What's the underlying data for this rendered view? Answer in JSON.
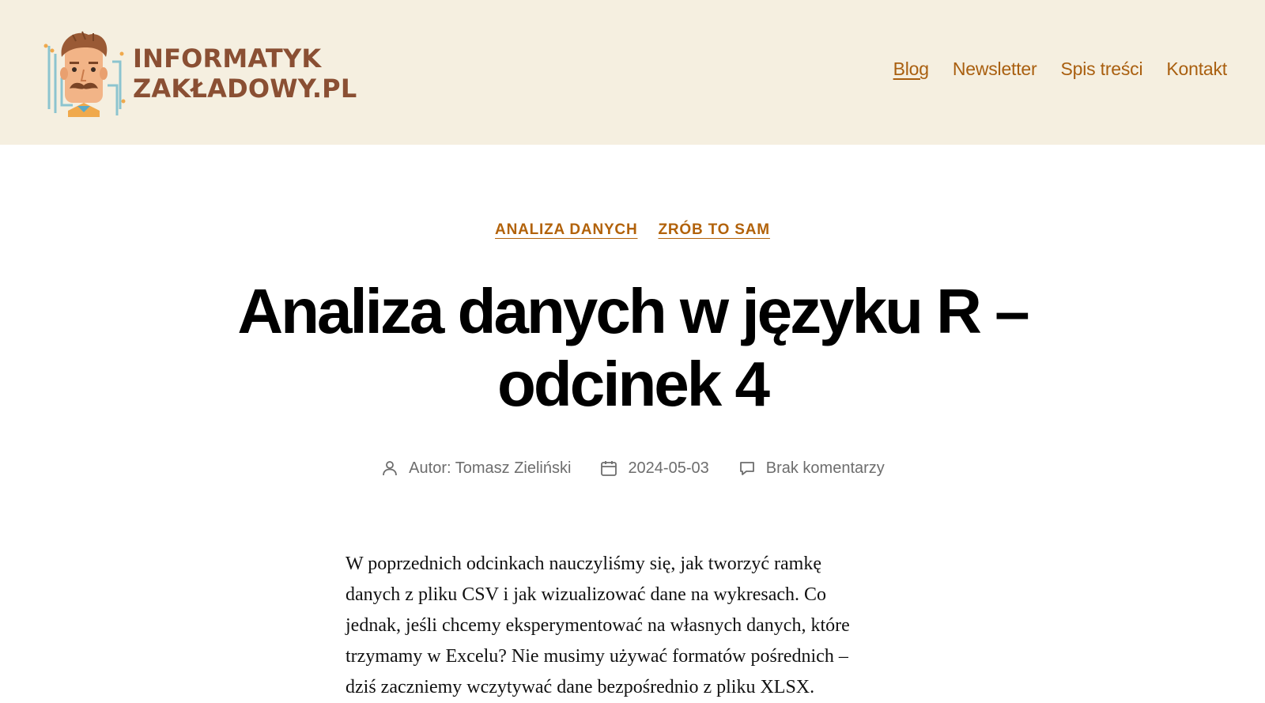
{
  "header": {
    "logo_line1": "INFORMATYK",
    "logo_line2": "ZAKŁADOWY.PL",
    "nav": [
      {
        "label": "Blog",
        "active": true
      },
      {
        "label": "Newsletter",
        "active": false
      },
      {
        "label": "Spis treści",
        "active": false
      },
      {
        "label": "Kontakt",
        "active": false
      }
    ]
  },
  "post": {
    "categories": [
      "ANALIZA DANYCH",
      "ZRÓB TO SAM"
    ],
    "title_line1": "Analiza danych w języku R –",
    "title_line2": "odcinek 4",
    "meta": {
      "author": "Autor: Tomasz Zieliński",
      "date": "2024-05-03",
      "comments": "Brak komentarzy"
    },
    "body_lines": [
      "W poprzednich odcinkach nauczyliśmy się, jak tworzyć ramkę",
      "danych z pliku CSV i jak wizualizować dane na wykresach. Co",
      "jednak, jeśli chcemy eksperymentować na własnych danych, które",
      "trzymamy w Excelu? Nie musimy używać formatów pośrednich –",
      "dziś zaczniemy wczytywać dane bezpośrednio z pliku XLSX."
    ]
  },
  "icons": {
    "author": "person-icon",
    "date": "calendar-icon",
    "comments": "comment-icon"
  },
  "colors": {
    "header_bg": "#f5efe0",
    "logo_text": "#8a4f33",
    "accent": "#b2620a",
    "meta_text": "#6d6d6d"
  }
}
